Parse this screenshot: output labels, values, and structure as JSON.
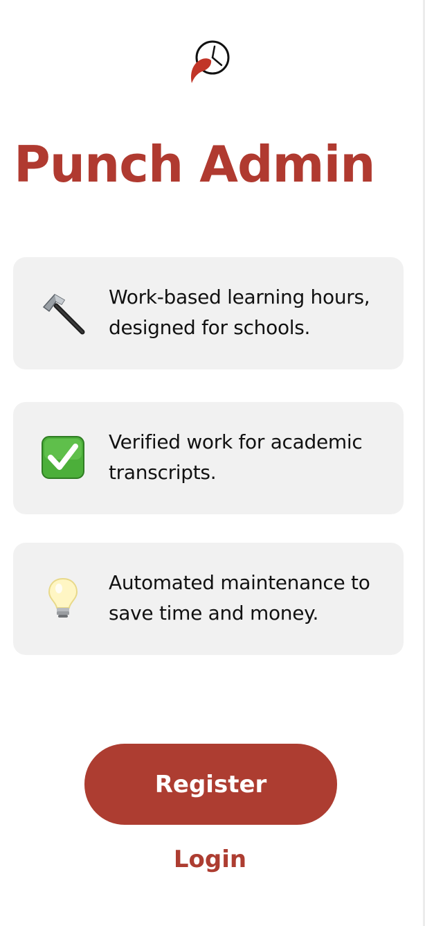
{
  "app": {
    "title": "Punch Admin",
    "logo_icon": "punch-clock-logo-icon",
    "brand_color": "#ad3d31"
  },
  "features": [
    {
      "icon": "hammer-icon",
      "text": "Work-based learning hours, designed for schools."
    },
    {
      "icon": "check-mark-button-icon",
      "text": "Verified work for academic transcripts."
    },
    {
      "icon": "light-bulb-icon",
      "text": "Automated maintenance to save time and money."
    }
  ],
  "actions": {
    "register_label": "Register",
    "login_label": "Login"
  }
}
